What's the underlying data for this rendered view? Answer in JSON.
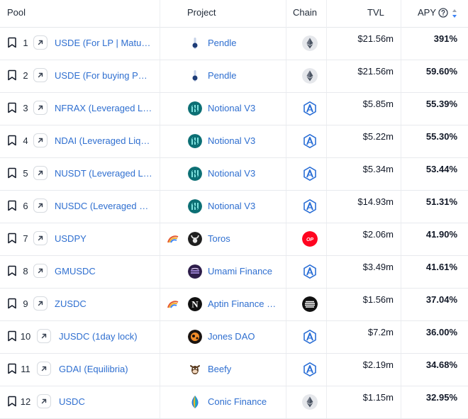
{
  "header": {
    "pool": "Pool",
    "project": "Project",
    "chain": "Chain",
    "tvl": "TVL",
    "apy": "APY",
    "help_icon": "question-circle-icon",
    "sort_icon": "sort-arrows-icon"
  },
  "colors": {
    "link": "#2f6fd0",
    "sort_active": "#3b82f6",
    "arbitrum": "#2b6fd6",
    "optimism": "#ff0420",
    "notional": "#0c6f74"
  },
  "rows": [
    {
      "rank": "1",
      "pool": "USDE (For LP | Matu…",
      "project": "Pendle",
      "project_icon": "pendle",
      "chain_icon": "ethereum",
      "tvl": "$21.56m",
      "apy": "391%",
      "rainbow": false
    },
    {
      "rank": "2",
      "pool": "USDE (For buying PT…",
      "project": "Pendle",
      "project_icon": "pendle",
      "chain_icon": "ethereum",
      "tvl": "$21.56m",
      "apy": "59.60%",
      "rainbow": false
    },
    {
      "rank": "3",
      "pool": "NFRAX (Leveraged Li…",
      "project": "Notional V3",
      "project_icon": "notional",
      "chain_icon": "arbitrum",
      "tvl": "$5.85m",
      "apy": "55.39%",
      "rainbow": false
    },
    {
      "rank": "4",
      "pool": "NDAI (Leveraged Liq…",
      "project": "Notional V3",
      "project_icon": "notional",
      "chain_icon": "arbitrum",
      "tvl": "$5.22m",
      "apy": "55.30%",
      "rainbow": false
    },
    {
      "rank": "5",
      "pool": "NUSDT (Leveraged Li…",
      "project": "Notional V3",
      "project_icon": "notional",
      "chain_icon": "arbitrum",
      "tvl": "$5.34m",
      "apy": "53.44%",
      "rainbow": false
    },
    {
      "rank": "6",
      "pool": "NUSDC (Leveraged Li…",
      "project": "Notional V3",
      "project_icon": "notional",
      "chain_icon": "arbitrum",
      "tvl": "$14.93m",
      "apy": "51.31%",
      "rainbow": false
    },
    {
      "rank": "7",
      "pool": "USDPY",
      "project": "Toros",
      "project_icon": "toros",
      "chain_icon": "optimism",
      "tvl": "$2.06m",
      "apy": "41.90%",
      "rainbow": true
    },
    {
      "rank": "8",
      "pool": "GMUSDC",
      "project": "Umami Finance",
      "project_icon": "umami",
      "chain_icon": "arbitrum",
      "tvl": "$3.49m",
      "apy": "41.61%",
      "rainbow": false
    },
    {
      "rank": "9",
      "pool": "ZUSDC",
      "project": "Aptin Finance …",
      "project_icon": "aptin",
      "chain_icon": "aptos",
      "tvl": "$1.56m",
      "apy": "37.04%",
      "rainbow": true
    },
    {
      "rank": "10",
      "pool": "JUSDC (1day lock)",
      "project": "Jones DAO",
      "project_icon": "jones",
      "chain_icon": "arbitrum",
      "tvl": "$7.2m",
      "apy": "36.00%",
      "rainbow": false
    },
    {
      "rank": "11",
      "pool": "GDAI (Equilibria)",
      "project": "Beefy",
      "project_icon": "beefy",
      "chain_icon": "arbitrum",
      "tvl": "$2.19m",
      "apy": "34.68%",
      "rainbow": false
    },
    {
      "rank": "12",
      "pool": "USDC",
      "project": "Conic Finance",
      "project_icon": "conic",
      "chain_icon": "ethereum",
      "tvl": "$1.15m",
      "apy": "32.95%",
      "rainbow": false
    }
  ],
  "chain_labels": {
    "optimism": "OP"
  },
  "project_labels": {
    "aptin": "N"
  }
}
